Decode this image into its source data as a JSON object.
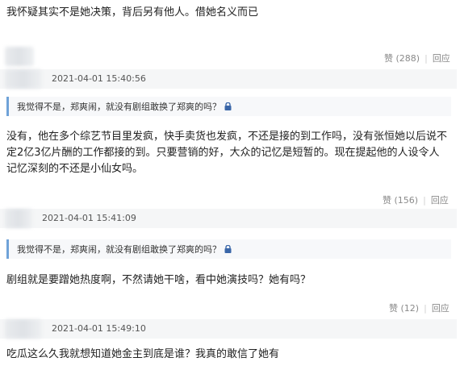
{
  "comments": [
    {
      "text": "我怀疑其实不是她决策，背后另有他人。借她名义而已",
      "like_label": "赞",
      "like_count": "(288)",
      "reply_label": "回应",
      "timestamp": "2021-04-01 15:40:56"
    },
    {
      "quote": "我觉得不是，郑爽闹，就没有剧组敢换了郑爽的吗？",
      "text": "没有，他在多个综艺节目里发疯，快手卖货也发疯，不还是接的到工作吗，没有张恒她以后说不定2亿3亿片酬的工作都接的到。只要营销的好，大众的记忆是短暂的。现在提起他的人设令人记忆深刻的不还是小仙女吗。",
      "like_label": "赞",
      "like_count": "(156)",
      "reply_label": "回应",
      "timestamp": "2021-04-01 15:41:09"
    },
    {
      "quote": "我觉得不是，郑爽闹，就没有剧组敢换了郑爽的吗？",
      "text": "剧组就是要蹭她热度啊，不然请她干啥，看中她演技吗？她有吗？",
      "like_label": "赞",
      "like_count": "(12)",
      "reply_label": "回应",
      "timestamp": "2021-04-01 15:49:10"
    },
    {
      "text": "吃瓜这么久我就想知道她金主到底是谁？我真的敢信了她有"
    }
  ],
  "colors": {
    "quote_border": "#6fa2d8",
    "meta_bg": "#f5f6f7",
    "action_text": "#8a8a8a"
  }
}
